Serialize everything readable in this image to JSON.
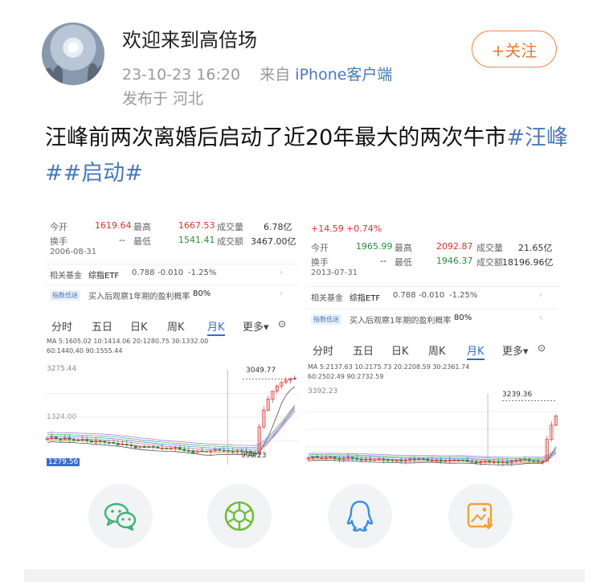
{
  "post": {
    "username": "欢迎来到高倍场",
    "time": "23-10-23 16:20",
    "source_prefix": "来自",
    "source_device": "iPhone客户端",
    "location": "发布于 河北",
    "follow_label": "+关注",
    "text_main": "汪峰前两次离婚后启动了近20年最大的两次牛市",
    "tags": [
      "#汪峰#",
      "#启动#"
    ]
  },
  "shot1": {
    "quote": {
      "open_label": "今开",
      "open": "1619.64",
      "high_label": "最高",
      "high": "1667.53",
      "volume_label": "成交量",
      "volume": "6.78亿",
      "turnover_label": "换手",
      "turnover": "--",
      "low_label": "最低",
      "low": "1541.41",
      "amount_label": "成交额",
      "amount": "3467.00亿",
      "date": "2006-08-31"
    },
    "fund": {
      "label": "相关基金",
      "name": "综指ETF",
      "price": "0.788",
      "change": "-0.010",
      "pct": "-1.25%"
    },
    "signal": {
      "badge": "指数低迷",
      "text": "买入后观察1年期的盈利概率",
      "prob": "80%"
    },
    "tabs": [
      "分时",
      "五日",
      "日K",
      "周K",
      "月K",
      "更多▾"
    ],
    "ma_line1": "MA 5:1605.02 10:1414.06 20:1280.75 30:1332.00",
    "ma_line2": "60:1440.40 90:1555.44",
    "max_label": "3275.44",
    "high_mark": "3049.77",
    "low_mark": "998.23",
    "mid_label": "1324.00",
    "left_bottom": "1279.56"
  },
  "shot2": {
    "quote": {
      "change": "+14.59",
      "change_pct": "+0.74%",
      "open_label": "今开",
      "open": "1965.99",
      "high_label": "最高",
      "high": "2092.87",
      "volume_label": "成交量",
      "volume": "21.65亿",
      "turnover_label": "换手",
      "turnover": "--",
      "low_label": "最低",
      "low": "1946.37",
      "amount_label": "成交额",
      "amount": "18196.96亿",
      "date": "2013-07-31"
    },
    "fund": {
      "label": "相关基金",
      "name": "综指ETF",
      "price": "0.788",
      "change": "-0.010",
      "pct": "-1.25%"
    },
    "signal": {
      "badge": "指数低迷",
      "text": "买入后观察1年期的盈利概率",
      "prob": "80%"
    },
    "tabs": [
      "分时",
      "五日",
      "日K",
      "周K",
      "月K",
      "更多▾"
    ],
    "ma_line1": "MA 5:2137.63 10:2175.73 20:2208.59 30:2361.74",
    "ma_line2": "60:2502.49 90:2732.59",
    "max_label": "3392.23",
    "high_mark": "3239.36"
  },
  "chart_data": [
    {
      "type": "line",
      "title": "",
      "period": "月K",
      "x": [
        "2006-08-31"
      ],
      "series": [
        {
          "name": "MA5",
          "values": [
            1605.02
          ]
        },
        {
          "name": "MA10",
          "values": [
            1414.06
          ]
        },
        {
          "name": "MA20",
          "values": [
            1280.75
          ]
        },
        {
          "name": "MA30",
          "values": [
            1332.0
          ]
        },
        {
          "name": "MA60",
          "values": [
            1440.4
          ]
        },
        {
          "name": "MA90",
          "values": [
            1555.44
          ]
        }
      ],
      "ohlc_latest": {
        "open": 1619.64,
        "high": 1667.53,
        "low": 1541.41
      },
      "annotations": {
        "max": 3275.44,
        "recent_high": 3049.77,
        "low": 998.23
      },
      "ylim": [
        998.23,
        3275.44
      ],
      "grid": true
    },
    {
      "type": "line",
      "title": "",
      "period": "月K",
      "x": [
        "2013-07-31"
      ],
      "series": [
        {
          "name": "MA5",
          "values": [
            2137.63
          ]
        },
        {
          "name": "MA10",
          "values": [
            2175.73
          ]
        },
        {
          "name": "MA20",
          "values": [
            2208.59
          ]
        },
        {
          "name": "MA30",
          "values": [
            2361.74
          ]
        },
        {
          "name": "MA60",
          "values": [
            2502.49
          ]
        },
        {
          "name": "MA90",
          "values": [
            2732.59
          ]
        }
      ],
      "ohlc_latest": {
        "open": 1965.99,
        "high": 2092.87,
        "low": 1946.37
      },
      "annotations": {
        "max": 3392.23,
        "recent_high": 3239.36
      },
      "ylim": [
        1800,
        3392.23
      ],
      "grid": true
    }
  ],
  "share": {
    "icons": [
      "wechat-icon",
      "moments-icon",
      "qq-icon",
      "save-image-icon"
    ],
    "colors": {
      "wechat": "#3cb371",
      "moments": "#6fbf3a",
      "qq": "#3d8de0",
      "save": "#f0a03a"
    }
  }
}
